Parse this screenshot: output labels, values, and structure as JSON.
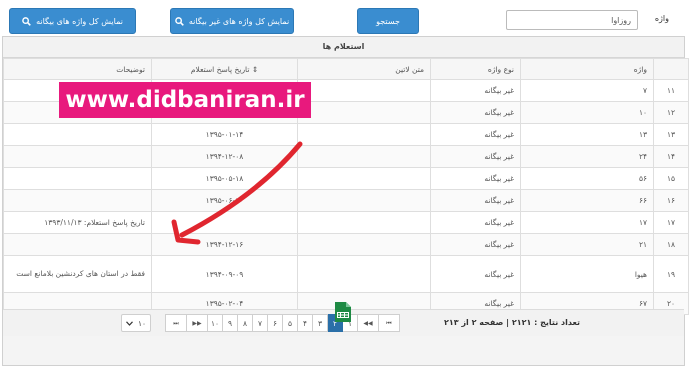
{
  "search": {
    "label": "واژه",
    "value": "روزاوا",
    "search_button": "جستجو",
    "show_foreign_button": "نمایش کل واژه های غیر بیگانه",
    "show_all_button": "نمایش کل واژه های بیگانه"
  },
  "table": {
    "title": "استعلام ها",
    "headers": {
      "word": "واژه",
      "type": "نوع واژه",
      "latin": "متن لاتین",
      "date": "تاریخ پاسخ استعلام ⇕",
      "notes": "توضیحات"
    },
    "rows": [
      {
        "idx": "۱۱",
        "word": "۷",
        "type": "غیر بیگانه",
        "latin": "",
        "date": "",
        "notes": ""
      },
      {
        "idx": "۱۲",
        "word": "۱۰",
        "type": "غیر بیگانه",
        "latin": "",
        "date": "",
        "notes": ""
      },
      {
        "idx": "۱۳",
        "word": "۱۳",
        "type": "غیر بیگانه",
        "latin": "",
        "date": "۱۳۹۵-۰۱-۱۴",
        "notes": ""
      },
      {
        "idx": "۱۴",
        "word": "۲۴",
        "type": "غیر بیگانه",
        "latin": "",
        "date": "۱۳۹۴-۱۲-۰۸",
        "notes": ""
      },
      {
        "idx": "۱۵",
        "word": "۵۶",
        "type": "غیر بیگانه",
        "latin": "",
        "date": "۱۳۹۵-۰۵-۱۸",
        "notes": ""
      },
      {
        "idx": "۱۶",
        "word": "۶۶",
        "type": "غیر بیگانه",
        "latin": "",
        "date": "۱۳۹۵-۰۶-۱۰",
        "notes": ""
      },
      {
        "idx": "۱۷",
        "word": "۱۷",
        "type": "غیر بیگانه",
        "latin": "",
        "date": "",
        "notes": "تاریخ پاسخ استعلام: ۱۳۹۳/۱۱/۱۳"
      },
      {
        "idx": "۱۸",
        "word": "۲۱",
        "type": "غیر بیگانه",
        "latin": "",
        "date": "۱۳۹۴-۱۲-۱۶",
        "notes": ""
      },
      {
        "idx": "۱۹",
        "word": "هیوا",
        "type": "غیر بیگانه",
        "latin": "",
        "date": "۱۳۹۴-۰۹-۰۹",
        "notes": "فقط در استان های کردنشین بلامانع است"
      },
      {
        "idx": "۲۰",
        "word": "۶۷",
        "type": "غیر بیگانه",
        "latin": "",
        "date": "۱۳۹۵-۰۲-۰۴",
        "notes": ""
      }
    ]
  },
  "pager": {
    "total": "تعداد نتایج : ۲۱۲۱ | صفحه ۲ از ۲۱۳",
    "pages": [
      "۱",
      "۲",
      "۳",
      "۴",
      "۵",
      "۶",
      "۷",
      "۸",
      "۹",
      "۱۰"
    ],
    "active_page": "۲",
    "per_page": "۱۰",
    "first": "⏮",
    "prev": "◀◀",
    "next": "▶▶",
    "last": "⏭"
  },
  "watermark": "www.didbaniran.ir",
  "colors": {
    "button": "#3a8dd0",
    "active_page": "#2a6fa8",
    "watermark": "#e8197d",
    "arrow": "#e0262f",
    "excel": "#1e8a44"
  },
  "icons": {
    "search": "search-icon",
    "excel": "excel-export-icon",
    "dropdown": "chevron-down-icon"
  }
}
